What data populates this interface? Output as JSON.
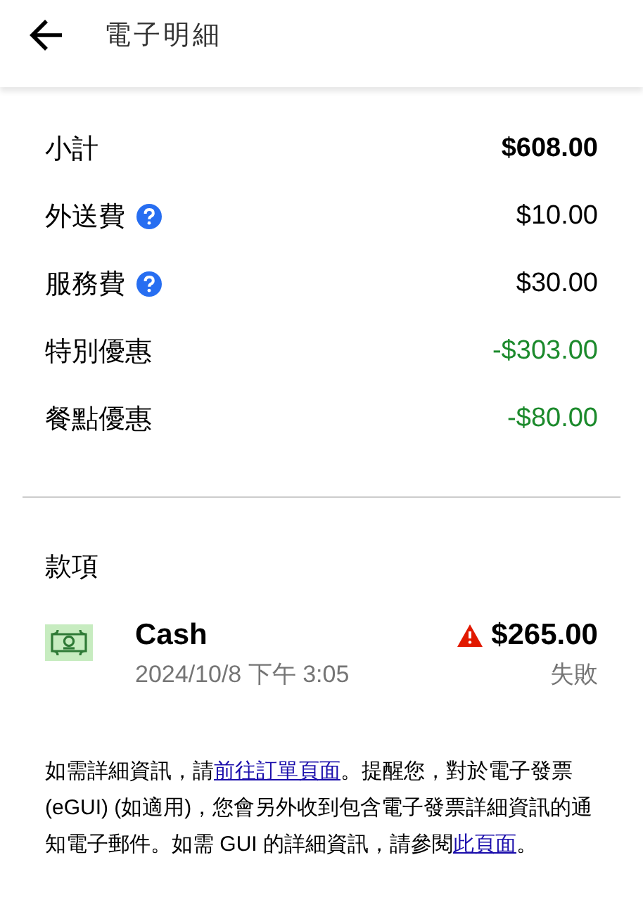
{
  "header": {
    "title": "電子明細"
  },
  "lines": [
    {
      "kind": "subtotal",
      "label": "小計",
      "info": false,
      "amount": "$608.00"
    },
    {
      "kind": "fee",
      "label": "外送費",
      "info": true,
      "amount": "$10.00"
    },
    {
      "kind": "fee",
      "label": "服務費",
      "info": true,
      "amount": "$30.00"
    },
    {
      "kind": "discount",
      "label": "特別優惠",
      "info": false,
      "amount": "-$303.00"
    },
    {
      "kind": "discount",
      "label": "餐點優惠",
      "info": false,
      "amount": "-$80.00"
    }
  ],
  "payments": {
    "heading": "款項",
    "items": [
      {
        "method": "Cash",
        "time": "2024/10/8 下午 3:05",
        "amount": "$265.00",
        "status": "失敗",
        "failed": true
      }
    ]
  },
  "note": [
    {
      "kind": "text",
      "text": "如需詳細資訊，請"
    },
    {
      "kind": "link",
      "text": "前往訂單頁面"
    },
    {
      "kind": "text",
      "text": "。提醒您，對於電子發票 (eGUI) (如適用)，您會另外收到包含電子發票詳細資訊的通知電子郵件。如需 GUI 的詳細資訊，請參閱"
    },
    {
      "kind": "link",
      "text": "此頁面"
    },
    {
      "kind": "text",
      "text": "。"
    }
  ]
}
